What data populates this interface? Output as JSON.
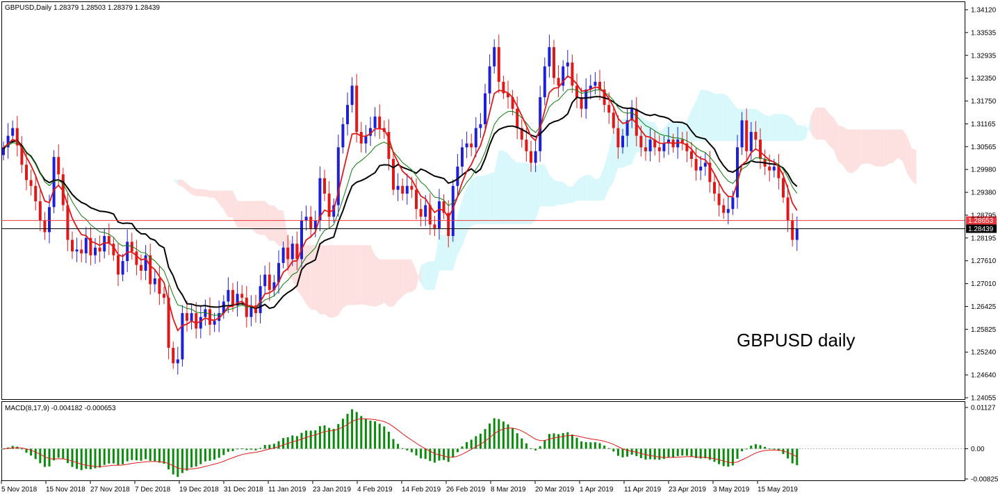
{
  "chart_data": [
    {
      "type": "candlestick",
      "info": "GBPUSD,Daily  1.28379 1.28503 1.28379 1.28439",
      "annotation": "GBPUSD daily",
      "ylim": [
        1.24055,
        1.3412
      ],
      "y_ticks": [
        "1.34120",
        "1.33535",
        "1.32935",
        "1.32350",
        "1.31750",
        "1.31165",
        "1.30565",
        "1.29980",
        "1.29380",
        "1.28795",
        "1.28195",
        "1.27610",
        "1.27010",
        "1.26425",
        "1.25825",
        "1.25240",
        "1.24640",
        "1.24055"
      ],
      "x_ticks": [
        "5 Nov 2018",
        "15 Nov 2018",
        "27 Nov 2018",
        "7 Dec 2018",
        "19 Dec 2018",
        "31 Dec 2018",
        "11 Jan 2019",
        "23 Jan 2019",
        "4 Feb 2019",
        "14 Feb 2019",
        "26 Feb 2019",
        "8 Mar 2019",
        "20 Mar 2019",
        "1 Apr 2019",
        "11 Apr 2019",
        "23 Apr 2019",
        "3 May 2019",
        "15 May 2019"
      ],
      "hlines": [
        {
          "value": 1.28653,
          "label": "1.28653",
          "color": "#e8383d"
        },
        {
          "value": 1.28439,
          "label": "1.28439",
          "color": "#000000"
        }
      ],
      "colors": {
        "up": "#1f1fd6",
        "down": "#e01818",
        "fast_line": "#e01818",
        "slow_line": "#0a7a0a",
        "base_line": "#000000",
        "cloud_up": "#d9f8fc",
        "cloud_down": "#fde0e0"
      },
      "closes": [
        1.3055,
        1.3085,
        1.3105,
        1.306,
        1.301,
        1.297,
        1.2955,
        1.2915,
        1.2865,
        1.2835,
        1.29,
        1.303,
        1.2985,
        1.2905,
        1.2815,
        1.2785,
        1.279,
        1.278,
        1.282,
        1.2775,
        1.2795,
        1.2785,
        1.2825,
        1.2805,
        1.2775,
        1.2725,
        1.276,
        1.281,
        1.2785,
        1.275,
        1.2735,
        1.2775,
        1.27,
        1.2715,
        1.2675,
        1.2665,
        1.2535,
        1.2495,
        1.2505,
        1.2625,
        1.2605,
        1.2625,
        1.2585,
        1.2615,
        1.2635,
        1.2595,
        1.2605,
        1.2625,
        1.2655,
        1.2685,
        1.2645,
        1.2675,
        1.2665,
        1.2615,
        1.2645,
        1.2625,
        1.2695,
        1.2725,
        1.2685,
        1.2705,
        1.2755,
        1.2795,
        1.2765,
        1.2805,
        1.2765,
        1.2865,
        1.2875,
        1.2845,
        1.2865,
        1.2975,
        1.2935,
        1.2875,
        1.2905,
        1.3055,
        1.3115,
        1.3165,
        1.3215,
        1.3095,
        1.3065,
        1.3085,
        1.3105,
        1.3135,
        1.3105,
        1.3095,
        1.3025,
        1.2945,
        1.2955,
        1.2935,
        1.2955,
        1.2945,
        1.2895,
        1.2875,
        1.2905,
        1.2855,
        1.2845,
        1.2915,
        1.2885,
        1.2825,
        1.2955,
        1.3005,
        1.3055,
        1.3065,
        1.3055,
        1.3105,
        1.3115,
        1.3195,
        1.3265,
        1.3315,
        1.3225,
        1.3195,
        1.3185,
        1.3155,
        1.3105,
        1.3075,
        1.3045,
        1.3015,
        1.3045,
        1.3185,
        1.3265,
        1.3315,
        1.3235,
        1.3215,
        1.3265,
        1.3275,
        1.3215,
        1.3185,
        1.3155,
        1.3205,
        1.3215,
        1.3225,
        1.3205,
        1.3165,
        1.3145,
        1.3105,
        1.3055,
        1.3085,
        1.3125,
        1.3155,
        1.3085,
        1.3055,
        1.3045,
        1.3075,
        1.3055,
        1.3045,
        1.3065,
        1.3075,
        1.3055,
        1.3075,
        1.3065,
        1.3045,
        1.3025,
        1.2995,
        1.3005,
        1.3015,
        1.2965,
        1.2935,
        1.2905,
        1.2885,
        1.2895,
        1.2925,
        1.3055,
        1.3125,
        1.3045,
        1.3095,
        1.3075,
        1.3025,
        1.3005,
        1.2995,
        1.3005,
        1.2975,
        1.2925,
        1.2865,
        1.2815,
        1.2844
      ]
    },
    {
      "type": "bar",
      "title": "MACD(8,17,9) -0.004182 -0.000653",
      "ylim": [
        -0.008258,
        0.01127
      ],
      "y_ticks": [
        "0.01127",
        "0.00",
        "-0.008258"
      ],
      "colors": {
        "histogram": "#0a8a0a",
        "signal": "#e01818",
        "zero_line": "#b0b0b0"
      }
    }
  ]
}
